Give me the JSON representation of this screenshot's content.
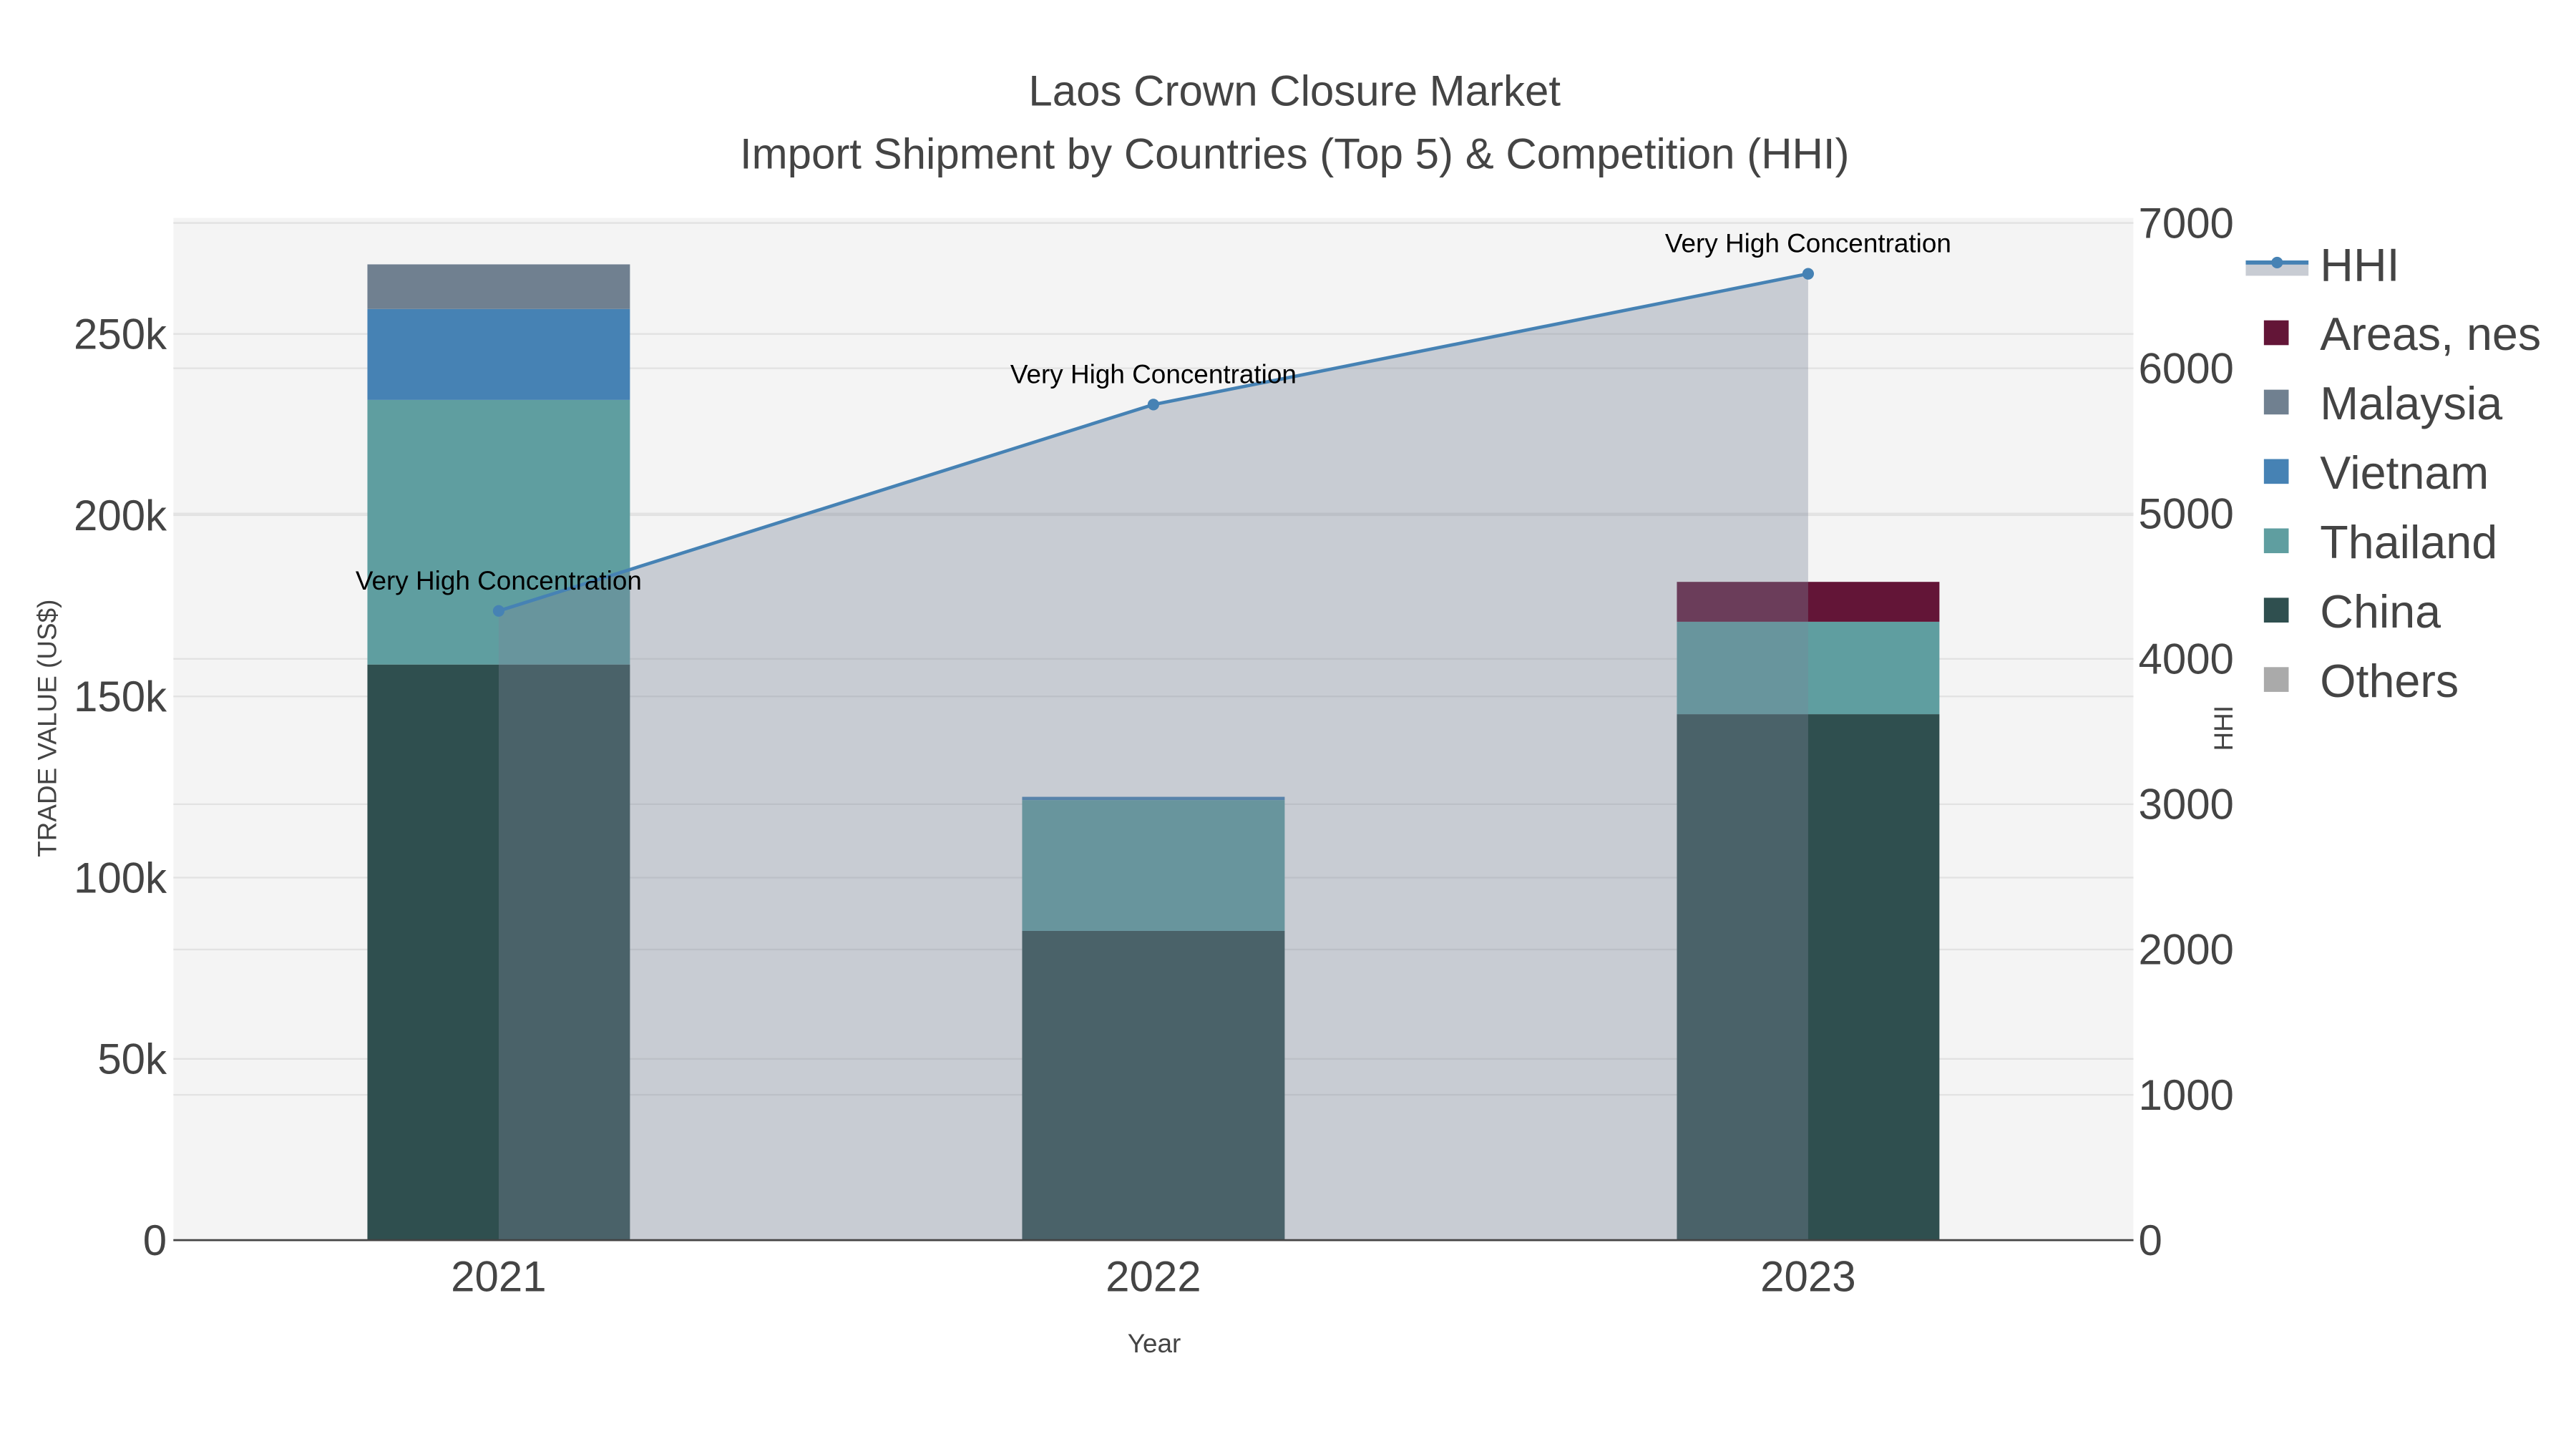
{
  "chart_data": {
    "type": "bar",
    "barmode": "stack",
    "title": "Laos Crown Closure Market",
    "subtitle": "Import Shipment by Countries (Top 5) & Competition (HHI)",
    "xlabel": "Year",
    "ylabel": "TRADE VALUE (US$)",
    "y2label": "HHI",
    "categories": [
      "2021",
      "2022",
      "2023"
    ],
    "ylim": [
      0,
      282000
    ],
    "y2lim": [
      0,
      7000
    ],
    "yticks": [
      0,
      50000,
      100000,
      150000,
      200000,
      250000
    ],
    "ytick_labels": [
      "0",
      "50k",
      "100k",
      "150k",
      "200k",
      "250k"
    ],
    "y2ticks": [
      0,
      1000,
      2000,
      3000,
      4000,
      5000,
      6000,
      7000
    ],
    "y2tick_labels": [
      "0",
      "1000",
      "2000",
      "3000",
      "4000",
      "5000",
      "6000",
      "7000"
    ],
    "grid": true,
    "legend_position": "right",
    "series": [
      {
        "name": "China",
        "color": "#2f4f4f",
        "values": [
          158800,
          85300,
          145100
        ]
      },
      {
        "name": "Thailand",
        "color": "#5f9ea0",
        "values": [
          73000,
          36100,
          25500
        ]
      },
      {
        "name": "Vietnam",
        "color": "#4682b4",
        "values": [
          25100,
          900,
          0
        ]
      },
      {
        "name": "Malaysia",
        "color": "#708090",
        "values": [
          12300,
          0,
          0
        ]
      },
      {
        "name": "Areas, nes",
        "color": "#631537",
        "values": [
          0,
          0,
          11000
        ]
      },
      {
        "name": "Others",
        "color": "#aaaaaa",
        "values": [
          0,
          0,
          0
        ]
      }
    ],
    "hhi": {
      "name": "HHI",
      "type": "line+area",
      "color": "#4682b4",
      "values": [
        4330,
        5750,
        6650
      ],
      "annotations": [
        "Very High Concentration",
        "Very High Concentration",
        "Very High Concentration"
      ]
    },
    "legend": [
      "HHI",
      "Areas, nes",
      "Malaysia",
      "Vietnam",
      "Thailand",
      "China",
      "Others"
    ]
  }
}
